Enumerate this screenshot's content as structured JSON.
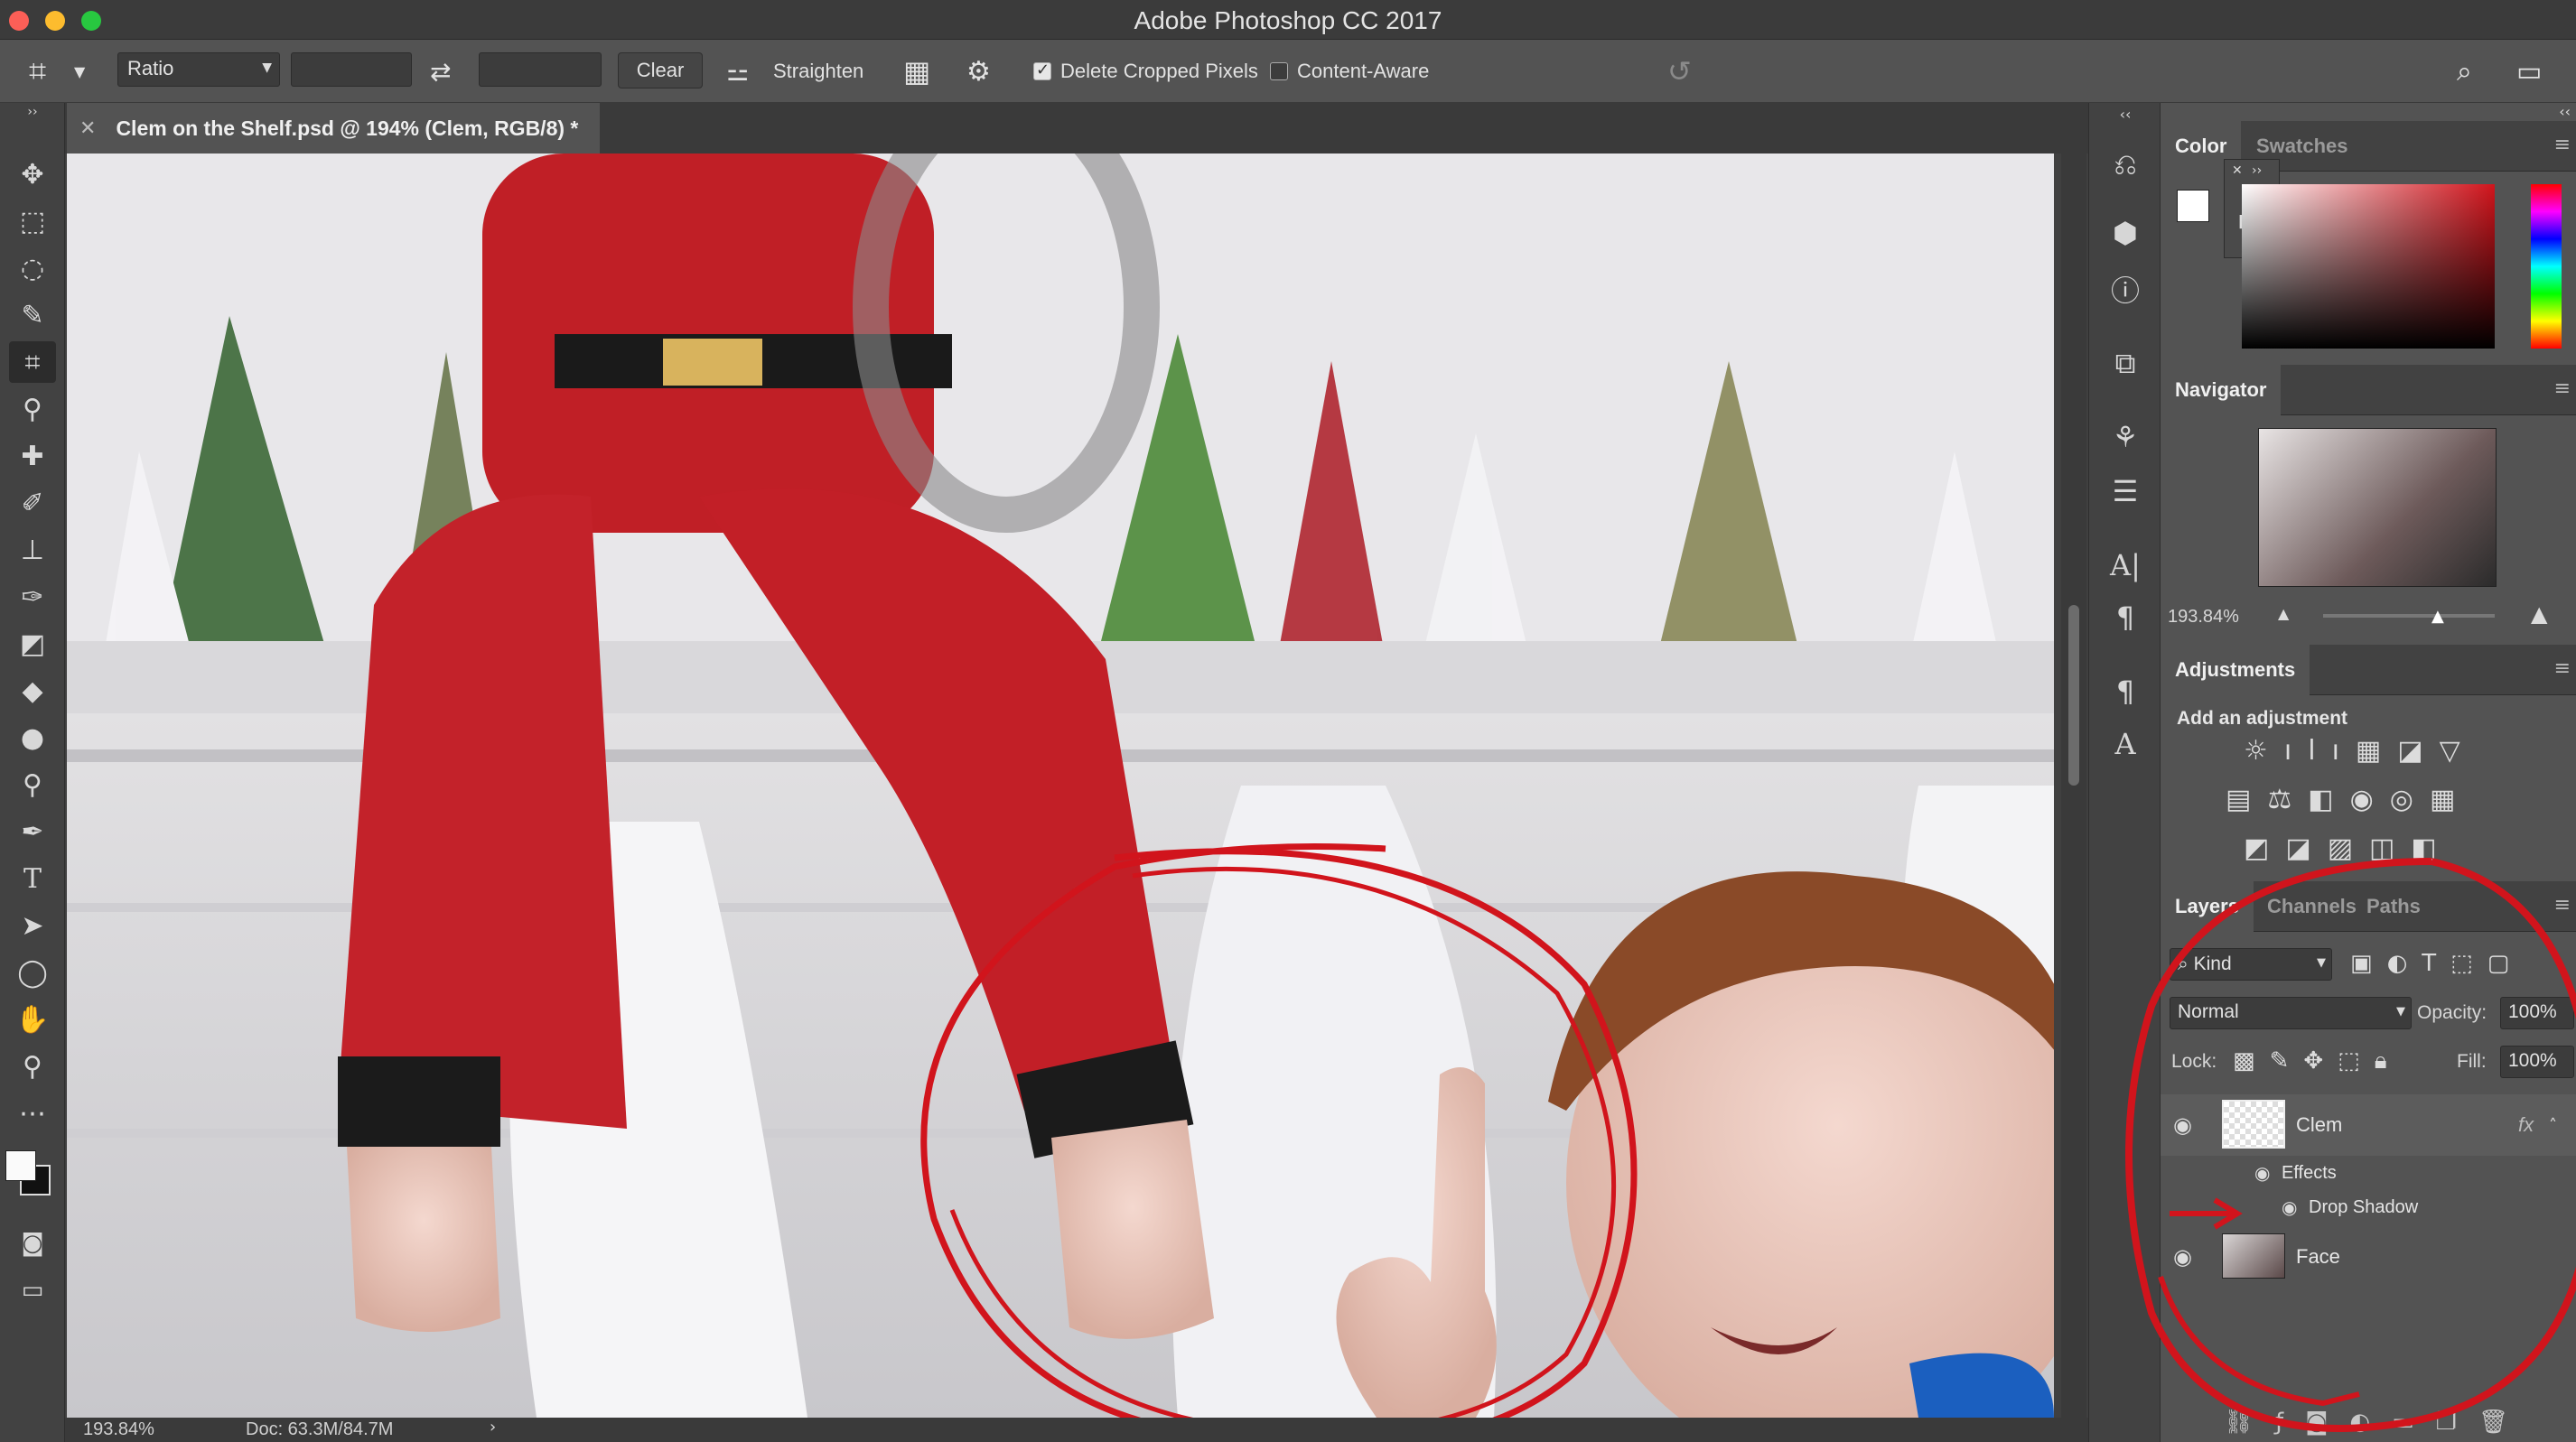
{
  "app": {
    "title": "Adobe Photoshop CC 2017"
  },
  "options": {
    "ratio_label": "Ratio",
    "clear_label": "Clear",
    "straighten_label": "Straighten",
    "delete_cropped_label": "Delete Cropped Pixels",
    "delete_cropped_checked": true,
    "content_aware_label": "Content-Aware",
    "content_aware_checked": false
  },
  "document": {
    "tab_title": "Clem on the Shelf.psd @ 194% (Clem, RGB/8) *",
    "zoom": "193.84%",
    "doc_info": "Doc: 63.3M/84.7M"
  },
  "panels": {
    "color_tabs": [
      "Color",
      "Swatches"
    ],
    "navigator": {
      "title": "Navigator",
      "zoom": "193.84%"
    },
    "adjustments": {
      "title": "Adjustments",
      "subtitle": "Add an adjustment"
    },
    "layers_tabs": [
      "Layers",
      "Channels",
      "Paths"
    ],
    "kind_label": "Kind",
    "blend_mode": "Normal",
    "opacity_label": "Opacity:",
    "opacity_value": "100%",
    "lock_label": "Lock:",
    "fill_label": "Fill:",
    "fill_value": "100%",
    "layers": [
      {
        "name": "Clem",
        "fx": "fx"
      },
      {
        "name": "Effects"
      },
      {
        "name": "Drop Shadow"
      },
      {
        "name": "Face"
      }
    ]
  },
  "colors": {
    "annotation_red": "#d1141c",
    "panel_bg": "#535353",
    "toolbar_bg": "#424242"
  }
}
